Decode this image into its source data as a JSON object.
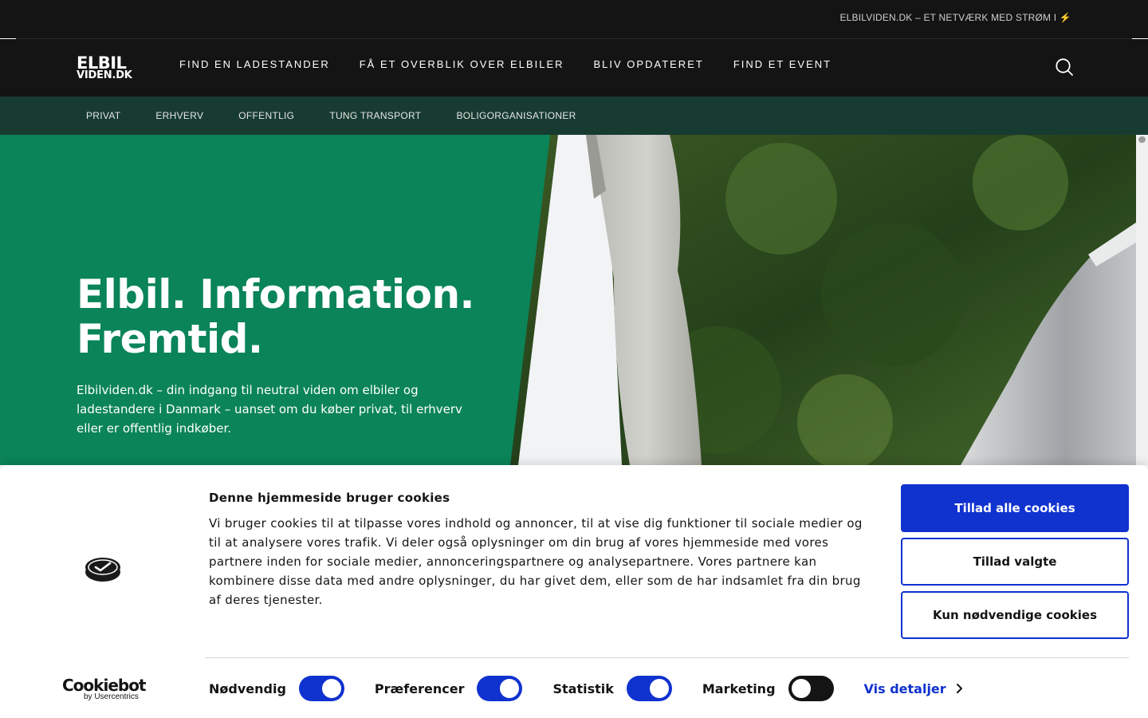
{
  "topbar": {
    "text": "ELBILVIDEN.DK – ET NETVÆRK MED STRØM I ⚡"
  },
  "logo": {
    "line1": "ELBIL",
    "line2": "VIDEN.DK"
  },
  "nav": {
    "items": [
      {
        "label": "FIND EN LADESTANDER"
      },
      {
        "label": "FÅ ET OVERBLIK OVER ELBILER"
      },
      {
        "label": "BLIV OPDATERET"
      },
      {
        "label": "FIND ET EVENT"
      }
    ],
    "search_icon": "search-icon"
  },
  "subnav": {
    "items": [
      {
        "label": "PRIVAT"
      },
      {
        "label": "ERHVERV"
      },
      {
        "label": "OFFENTLIG"
      },
      {
        "label": "TUNG TRANSPORT"
      },
      {
        "label": "BOLIGORGANISATIONER"
      }
    ]
  },
  "hero": {
    "title_line1": "Elbil. Information.",
    "title_line2": "Fremtid.",
    "description": "Elbilviden.dk – din indgang til neutral viden om elbiler og ladestandere i Danmark – uanset om du køber privat, til erhverv eller er offentlig indkøber."
  },
  "cookie": {
    "title": "Denne hjemmeside bruger cookies",
    "body": "Vi bruger cookies til at tilpasse vores indhold og annoncer, til at vise dig funktioner til sociale medier og til at analysere vores trafik. Vi deler også oplysninger om din brug af vores hjemmeside med vores partnere inden for sociale medier, annonceringspartnere og analysepartnere. Vores partnere kan kombinere disse data med andre oplysninger, du har givet dem, eller som de har indsamlet fra din brug af deres tjenester.",
    "buttons": {
      "allow_all": "Tillad alle cookies",
      "allow_selected": "Tillad valgte",
      "necessary_only": "Kun nødvendige cookies"
    },
    "toggles": [
      {
        "label": "Nødvendig",
        "on": true
      },
      {
        "label": "Præferencer",
        "on": true
      },
      {
        "label": "Statistik",
        "on": true
      },
      {
        "label": "Marketing",
        "on": false
      }
    ],
    "details_link": "Vis detaljer",
    "brand": {
      "name": "Cookiebot",
      "by": "by Usercentrics"
    }
  },
  "colors": {
    "topbar": "#141414",
    "subnav": "#173b31",
    "hero_green": "#0a8458",
    "accent_blue": "#1032cf"
  }
}
